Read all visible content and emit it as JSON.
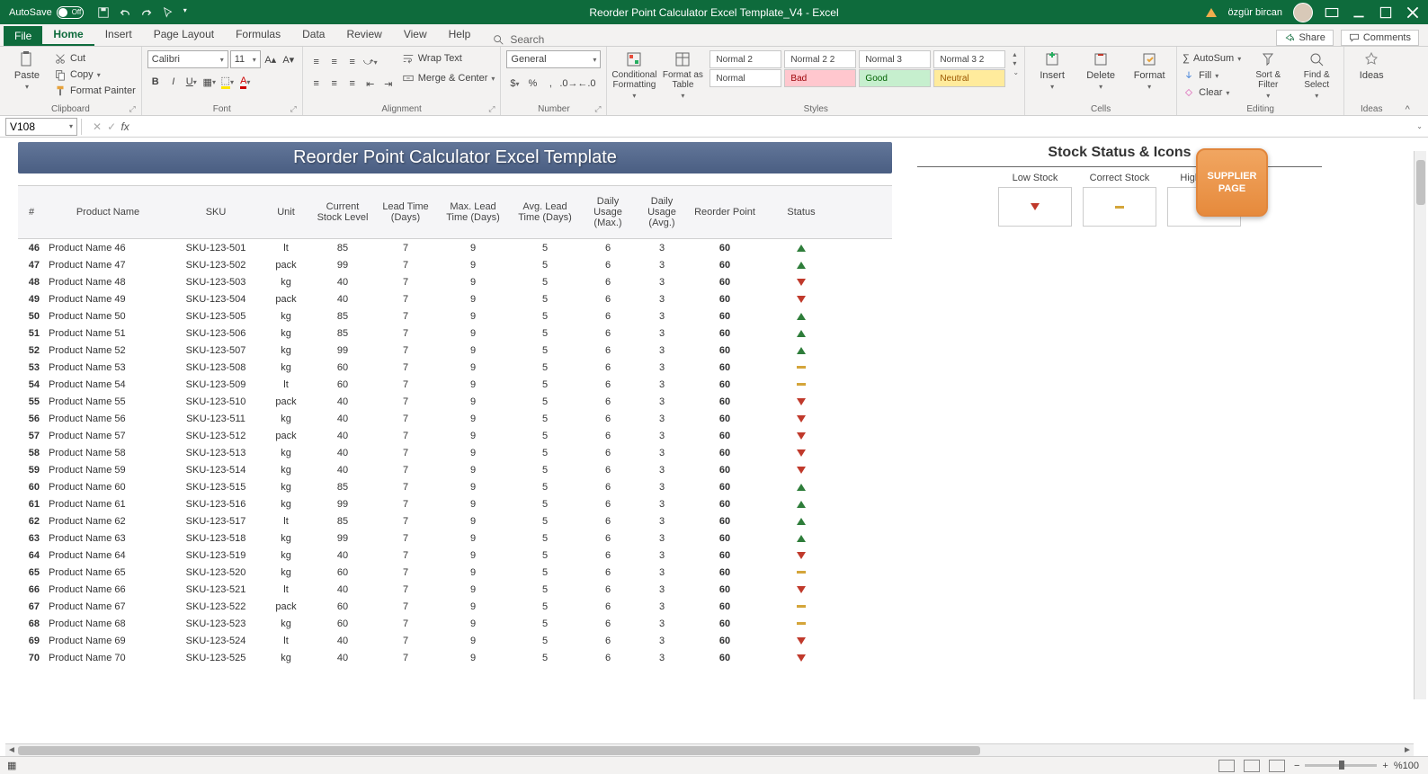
{
  "titlebar": {
    "autosave_label": "AutoSave",
    "autosave_state": "Off",
    "title": "Reorder Point Calculator Excel Template_V4  -  Excel",
    "username": "özgür bircan"
  },
  "tabs": {
    "file": "File",
    "items": [
      "Home",
      "Insert",
      "Page Layout",
      "Formulas",
      "Data",
      "Review",
      "View",
      "Help"
    ],
    "active": "Home",
    "search": "Search",
    "share": "Share",
    "comments": "Comments"
  },
  "ribbon": {
    "clipboard": {
      "label": "Clipboard",
      "paste": "Paste",
      "cut": "Cut",
      "copy": "Copy",
      "fp": "Format Painter"
    },
    "font": {
      "label": "Font",
      "name": "Calibri",
      "size": "11"
    },
    "alignment": {
      "label": "Alignment",
      "wrap": "Wrap Text",
      "merge": "Merge & Center"
    },
    "number": {
      "label": "Number",
      "format": "General"
    },
    "styles": {
      "label": "Styles",
      "cond": "Conditional Formatting",
      "fat": "Format as Table",
      "cells": [
        "Normal 2",
        "Normal 2 2",
        "Normal 3",
        "Normal 3 2",
        "Normal",
        "Bad",
        "Good",
        "Neutral"
      ]
    },
    "cells": {
      "label": "Cells",
      "insert": "Insert",
      "delete": "Delete",
      "format": "Format"
    },
    "editing": {
      "label": "Editing",
      "autosum": "AutoSum",
      "fill": "Fill",
      "clear": "Clear",
      "sort": "Sort & Filter",
      "find": "Find & Select"
    },
    "ideas": {
      "label": "Ideas",
      "btn": "Ideas"
    }
  },
  "formula_bar": {
    "cell_ref": "V108",
    "formula": ""
  },
  "template": {
    "title": "Reorder Point Calculator Excel Template",
    "headers": {
      "num": "#",
      "name": "Product Name",
      "sku": "SKU",
      "unit": "Unit",
      "curr": "Current Stock Level",
      "lead": "Lead Time (Days)",
      "max": "Max. Lead Time (Days)",
      "avg": "Avg. Lead Time (Days)",
      "dmax": "Daily Usage (Max.)",
      "davg": "Daily Usage (Avg.)",
      "reord": "Reorder Point",
      "status": "Status"
    },
    "rows": [
      {
        "n": "46",
        "name": "Product Name 46",
        "sku": "SKU-123-501",
        "unit": "lt",
        "curr": "85",
        "lead": "7",
        "max": "9",
        "avg": "5",
        "dmax": "6",
        "davg": "3",
        "reord": "60",
        "status": "up"
      },
      {
        "n": "47",
        "name": "Product Name 47",
        "sku": "SKU-123-502",
        "unit": "pack",
        "curr": "99",
        "lead": "7",
        "max": "9",
        "avg": "5",
        "dmax": "6",
        "davg": "3",
        "reord": "60",
        "status": "up"
      },
      {
        "n": "48",
        "name": "Product Name 48",
        "sku": "SKU-123-503",
        "unit": "kg",
        "curr": "40",
        "lead": "7",
        "max": "9",
        "avg": "5",
        "dmax": "6",
        "davg": "3",
        "reord": "60",
        "status": "down"
      },
      {
        "n": "49",
        "name": "Product Name 49",
        "sku": "SKU-123-504",
        "unit": "pack",
        "curr": "40",
        "lead": "7",
        "max": "9",
        "avg": "5",
        "dmax": "6",
        "davg": "3",
        "reord": "60",
        "status": "down"
      },
      {
        "n": "50",
        "name": "Product Name 50",
        "sku": "SKU-123-505",
        "unit": "kg",
        "curr": "85",
        "lead": "7",
        "max": "9",
        "avg": "5",
        "dmax": "6",
        "davg": "3",
        "reord": "60",
        "status": "up"
      },
      {
        "n": "51",
        "name": "Product Name 51",
        "sku": "SKU-123-506",
        "unit": "kg",
        "curr": "85",
        "lead": "7",
        "max": "9",
        "avg": "5",
        "dmax": "6",
        "davg": "3",
        "reord": "60",
        "status": "up"
      },
      {
        "n": "52",
        "name": "Product Name 52",
        "sku": "SKU-123-507",
        "unit": "kg",
        "curr": "99",
        "lead": "7",
        "max": "9",
        "avg": "5",
        "dmax": "6",
        "davg": "3",
        "reord": "60",
        "status": "up"
      },
      {
        "n": "53",
        "name": "Product Name 53",
        "sku": "SKU-123-508",
        "unit": "kg",
        "curr": "60",
        "lead": "7",
        "max": "9",
        "avg": "5",
        "dmax": "6",
        "davg": "3",
        "reord": "60",
        "status": "eq"
      },
      {
        "n": "54",
        "name": "Product Name 54",
        "sku": "SKU-123-509",
        "unit": "lt",
        "curr": "60",
        "lead": "7",
        "max": "9",
        "avg": "5",
        "dmax": "6",
        "davg": "3",
        "reord": "60",
        "status": "eq"
      },
      {
        "n": "55",
        "name": "Product Name 55",
        "sku": "SKU-123-510",
        "unit": "pack",
        "curr": "40",
        "lead": "7",
        "max": "9",
        "avg": "5",
        "dmax": "6",
        "davg": "3",
        "reord": "60",
        "status": "down"
      },
      {
        "n": "56",
        "name": "Product Name 56",
        "sku": "SKU-123-511",
        "unit": "kg",
        "curr": "40",
        "lead": "7",
        "max": "9",
        "avg": "5",
        "dmax": "6",
        "davg": "3",
        "reord": "60",
        "status": "down"
      },
      {
        "n": "57",
        "name": "Product Name 57",
        "sku": "SKU-123-512",
        "unit": "pack",
        "curr": "40",
        "lead": "7",
        "max": "9",
        "avg": "5",
        "dmax": "6",
        "davg": "3",
        "reord": "60",
        "status": "down"
      },
      {
        "n": "58",
        "name": "Product Name 58",
        "sku": "SKU-123-513",
        "unit": "kg",
        "curr": "40",
        "lead": "7",
        "max": "9",
        "avg": "5",
        "dmax": "6",
        "davg": "3",
        "reord": "60",
        "status": "down"
      },
      {
        "n": "59",
        "name": "Product Name 59",
        "sku": "SKU-123-514",
        "unit": "kg",
        "curr": "40",
        "lead": "7",
        "max": "9",
        "avg": "5",
        "dmax": "6",
        "davg": "3",
        "reord": "60",
        "status": "down"
      },
      {
        "n": "60",
        "name": "Product Name 60",
        "sku": "SKU-123-515",
        "unit": "kg",
        "curr": "85",
        "lead": "7",
        "max": "9",
        "avg": "5",
        "dmax": "6",
        "davg": "3",
        "reord": "60",
        "status": "up"
      },
      {
        "n": "61",
        "name": "Product Name 61",
        "sku": "SKU-123-516",
        "unit": "kg",
        "curr": "99",
        "lead": "7",
        "max": "9",
        "avg": "5",
        "dmax": "6",
        "davg": "3",
        "reord": "60",
        "status": "up"
      },
      {
        "n": "62",
        "name": "Product Name 62",
        "sku": "SKU-123-517",
        "unit": "lt",
        "curr": "85",
        "lead": "7",
        "max": "9",
        "avg": "5",
        "dmax": "6",
        "davg": "3",
        "reord": "60",
        "status": "up"
      },
      {
        "n": "63",
        "name": "Product Name 63",
        "sku": "SKU-123-518",
        "unit": "kg",
        "curr": "99",
        "lead": "7",
        "max": "9",
        "avg": "5",
        "dmax": "6",
        "davg": "3",
        "reord": "60",
        "status": "up"
      },
      {
        "n": "64",
        "name": "Product Name 64",
        "sku": "SKU-123-519",
        "unit": "kg",
        "curr": "40",
        "lead": "7",
        "max": "9",
        "avg": "5",
        "dmax": "6",
        "davg": "3",
        "reord": "60",
        "status": "down"
      },
      {
        "n": "65",
        "name": "Product Name 65",
        "sku": "SKU-123-520",
        "unit": "kg",
        "curr": "60",
        "lead": "7",
        "max": "9",
        "avg": "5",
        "dmax": "6",
        "davg": "3",
        "reord": "60",
        "status": "eq"
      },
      {
        "n": "66",
        "name": "Product Name 66",
        "sku": "SKU-123-521",
        "unit": "lt",
        "curr": "40",
        "lead": "7",
        "max": "9",
        "avg": "5",
        "dmax": "6",
        "davg": "3",
        "reord": "60",
        "status": "down"
      },
      {
        "n": "67",
        "name": "Product Name 67",
        "sku": "SKU-123-522",
        "unit": "pack",
        "curr": "60",
        "lead": "7",
        "max": "9",
        "avg": "5",
        "dmax": "6",
        "davg": "3",
        "reord": "60",
        "status": "eq"
      },
      {
        "n": "68",
        "name": "Product Name 68",
        "sku": "SKU-123-523",
        "unit": "kg",
        "curr": "60",
        "lead": "7",
        "max": "9",
        "avg": "5",
        "dmax": "6",
        "davg": "3",
        "reord": "60",
        "status": "eq"
      },
      {
        "n": "69",
        "name": "Product Name 69",
        "sku": "SKU-123-524",
        "unit": "lt",
        "curr": "40",
        "lead": "7",
        "max": "9",
        "avg": "5",
        "dmax": "6",
        "davg": "3",
        "reord": "60",
        "status": "down"
      },
      {
        "n": "70",
        "name": "Product Name 70",
        "sku": "SKU-123-525",
        "unit": "kg",
        "curr": "40",
        "lead": "7",
        "max": "9",
        "avg": "5",
        "dmax": "6",
        "davg": "3",
        "reord": "60",
        "status": "down"
      }
    ]
  },
  "side": {
    "title": "Stock Status & Icons",
    "low": "Low Stock",
    "correct": "Correct Stock",
    "high": "High Stock",
    "supplier": "SUPPLIER PAGE"
  },
  "status": {
    "zoom": "%100"
  }
}
